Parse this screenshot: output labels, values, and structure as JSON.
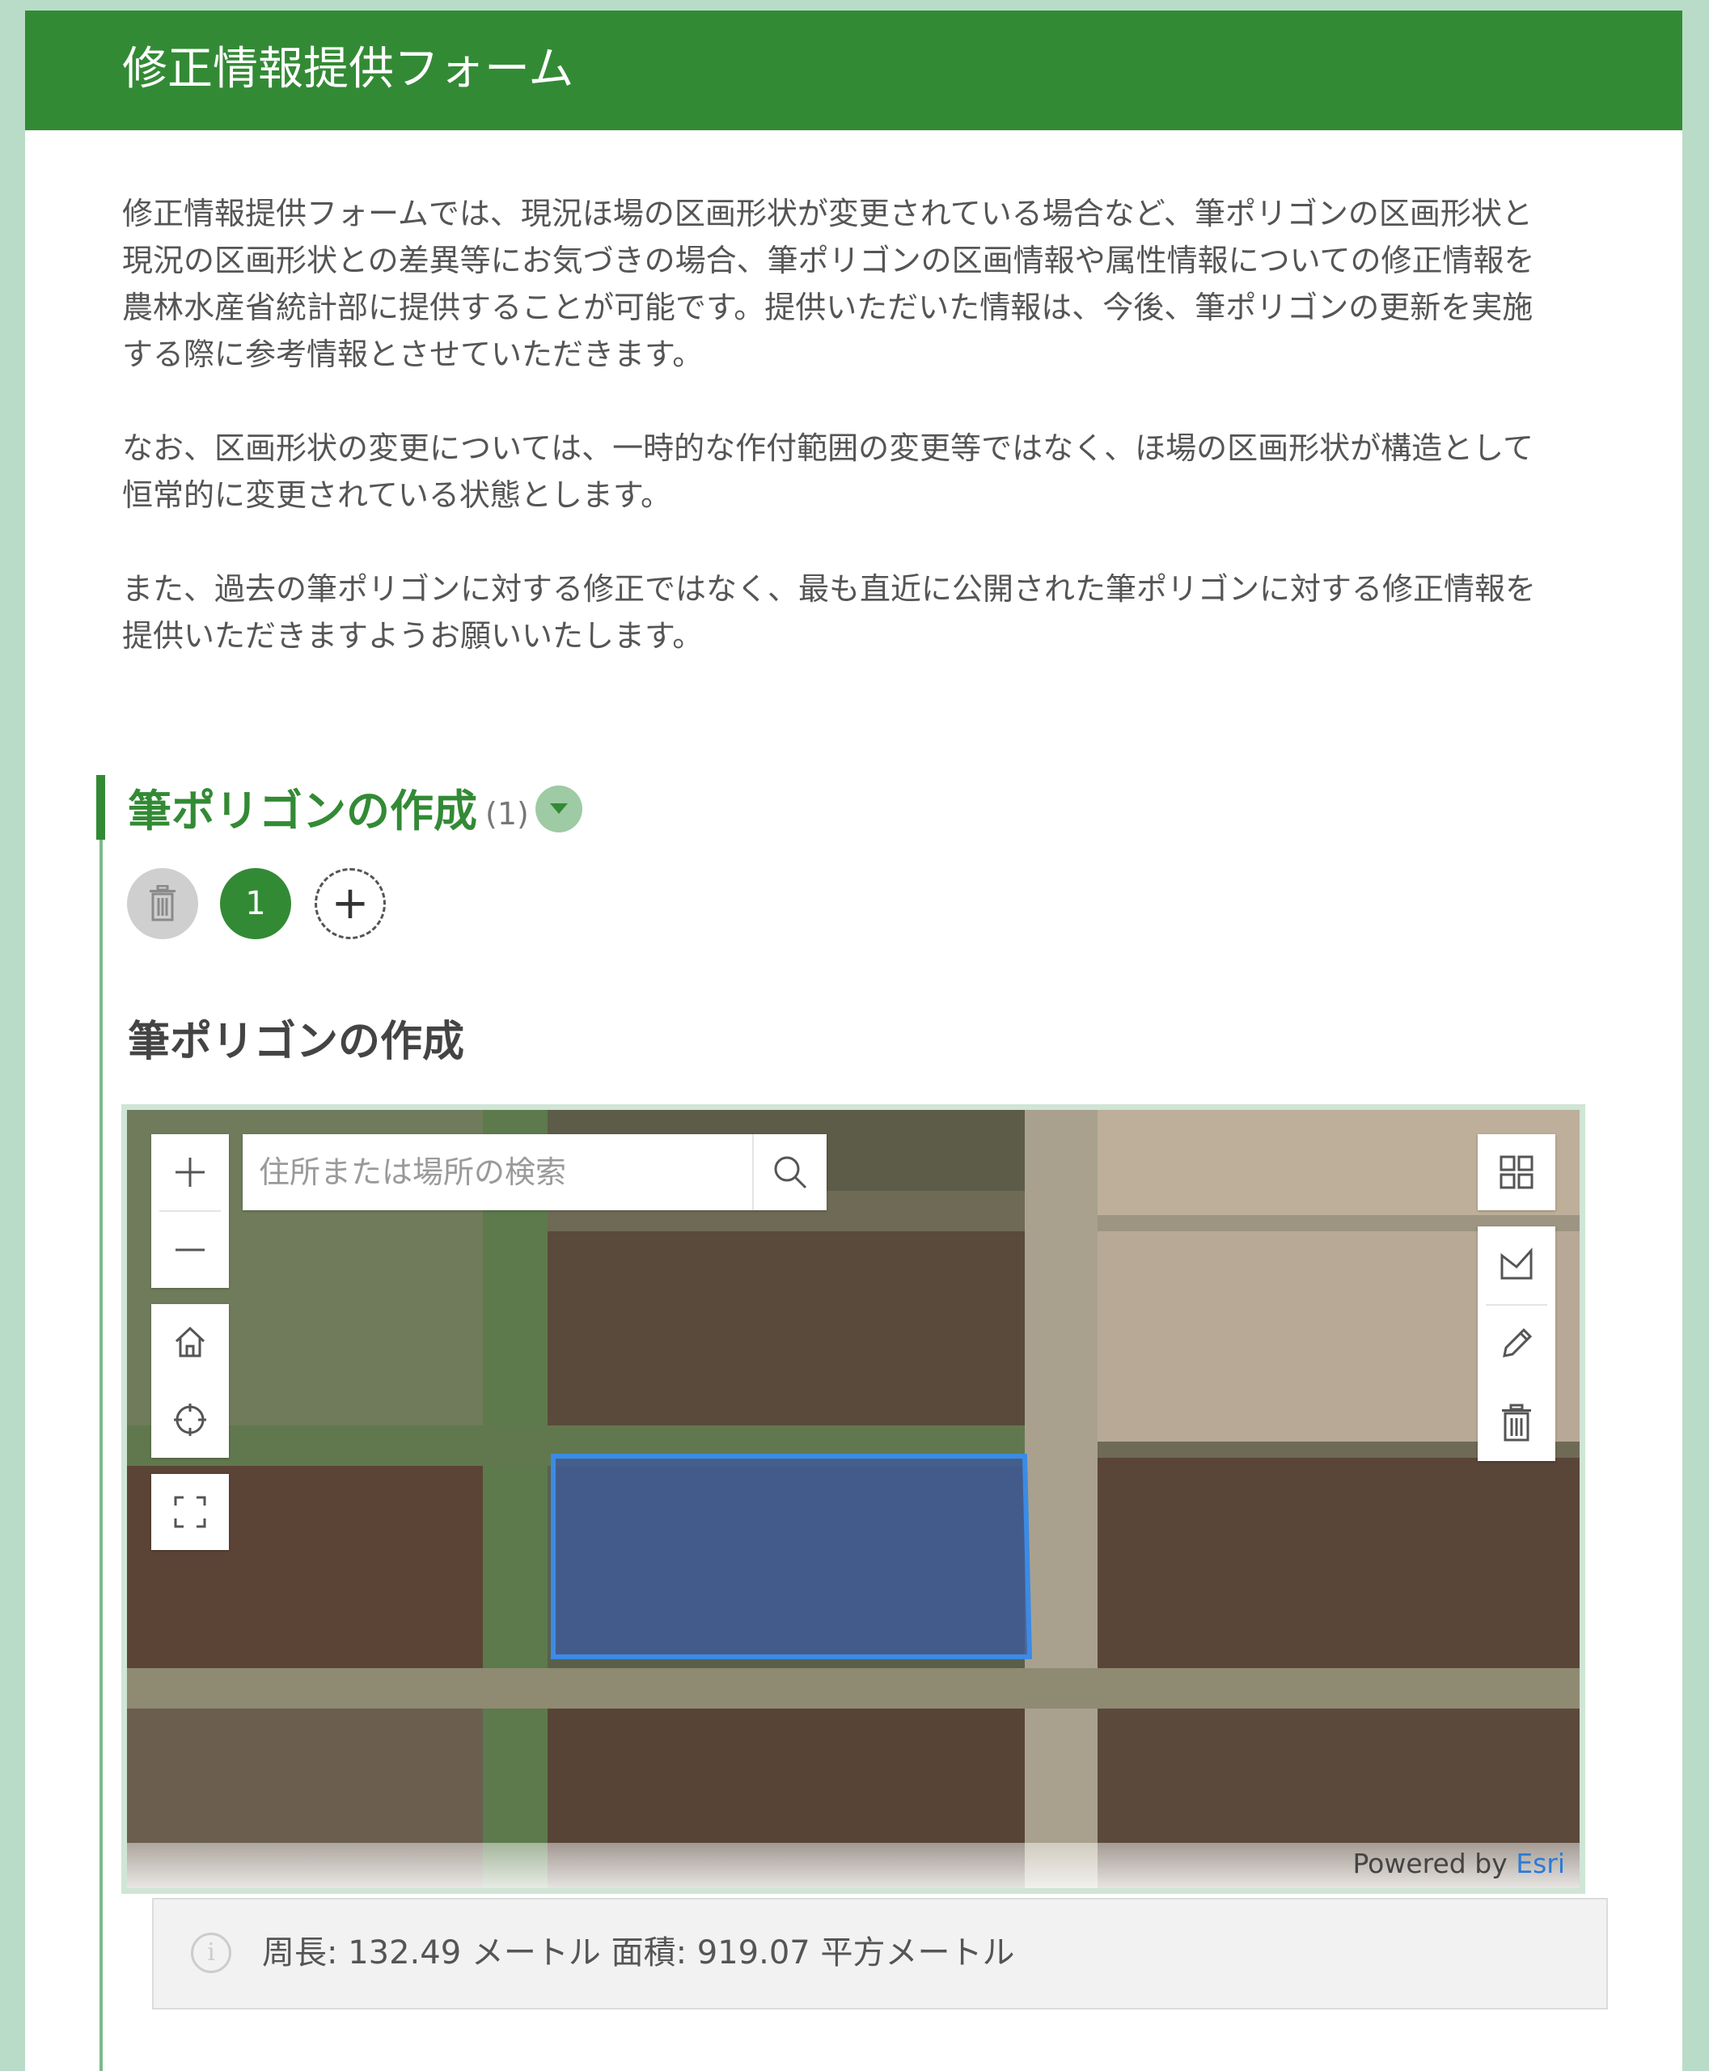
{
  "form": {
    "title": "修正情報提供フォーム",
    "intro_paragraphs": [
      "修正情報提供フォームでは、現況ほ場の区画形状が変更されている場合など、筆ポリゴンの区画形状と現況の区画形状との差異等にお気づきの場合、筆ポリゴンの区画情報や属性情報についての修正情報を農林水産省統計部に提供することが可能です。提供いただいた情報は、今後、筆ポリゴンの更新を実施する際に参考情報とさせていただきます。",
      "なお、区画形状の変更については、一時的な作付範囲の変更等ではなく、ほ場の区画形状が構造として恒常的に変更されている状態とします。",
      "また、過去の筆ポリゴンに対する修正ではなく、最も直近に公開された筆ポリゴンに対する修正情報を提供いただきますようお願いいたします。"
    ]
  },
  "section": {
    "title": "筆ポリゴンの作成",
    "count": "(1)",
    "current_page": "1",
    "question_label": "筆ポリゴンの作成"
  },
  "map": {
    "search_placeholder": "住所または場所の検索",
    "attribution_prefix": "Powered by ",
    "attribution_link": "Esri",
    "polygon_color": "#3b8be6"
  },
  "measurement": {
    "text": "周長: 132.49 メートル 面積: 919.07 平方メートル"
  },
  "icons": {
    "header": [],
    "map_left": [
      "zoom-in-icon",
      "zoom-out-icon",
      "home-icon",
      "locate-icon",
      "fullscreen-icon"
    ],
    "map_right": [
      "basemap-gallery-icon",
      "draw-polygon-icon",
      "edit-pencil-icon",
      "trash-icon"
    ]
  },
  "colors": {
    "brand_green": "#338a35",
    "background": "#b9dcc8"
  }
}
